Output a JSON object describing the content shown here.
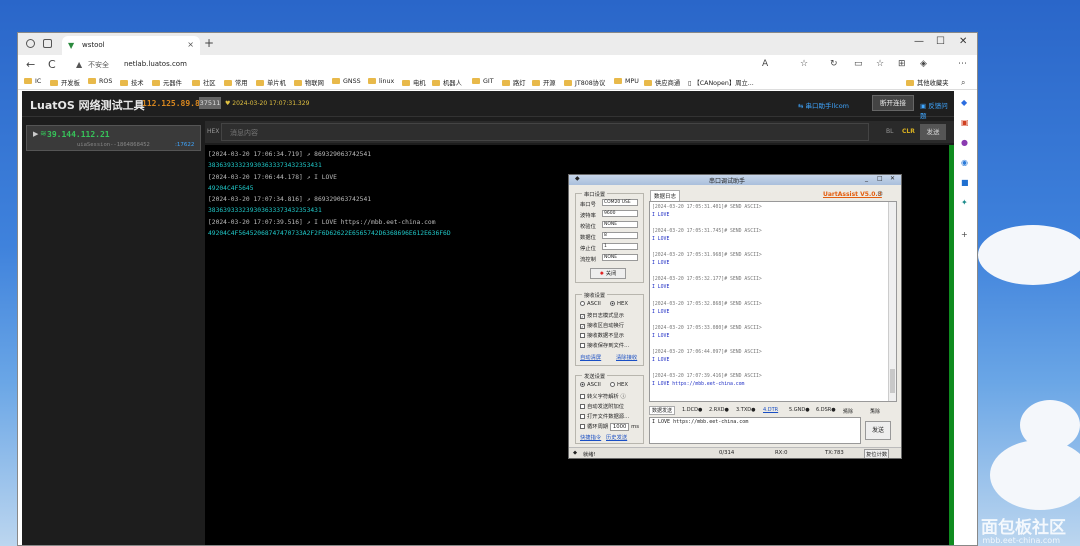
{
  "browser": {
    "tab_title": "wstool",
    "tab_close": "×",
    "new_tab": "+",
    "win_min": "—",
    "win_max": "☐",
    "win_close": "✕",
    "insecure_label": "不安全",
    "url": "netlab.luatos.com",
    "nav_back": "←",
    "nav_refresh": "C",
    "bookmarks": [
      "IC",
      "开发板",
      "ROS",
      "技术",
      "元器件",
      "社区",
      "常用",
      "单片机",
      "物联网",
      "GNSS",
      "linux",
      "电机",
      "机器人",
      "GIT",
      "路灯",
      "开源",
      "JT808协议",
      "MPU",
      "供应商通",
      "【CANopen】周立..."
    ],
    "other_bookmarks": "其他收藏夹"
  },
  "app": {
    "logo": "LuatOS 网络测试工具",
    "server_ip": "112.125.89.8:",
    "server_port": "37511",
    "connected_time": "2024-03-20 17:07:31.329",
    "assist_link": "串口助手llcom",
    "disconnect_label": "断开连接",
    "feedback_link": "反馈问题",
    "client": {
      "ip": "39.144.112.21",
      "session": "uiaSession--1864868452",
      "port_count": ":17622"
    },
    "sendbar": {
      "hex_label": "HEX",
      "placeholder": "消息内容",
      "bl_label": "BL",
      "clr_label": "CLR",
      "send_label": "发送"
    },
    "log": [
      {
        "ts": "[2024-03-20 17:06:34.719]",
        "msg": "869329063742541",
        "data": "383639333239303633373432353431"
      },
      {
        "ts": "[2024-03-20 17:06:44.178]",
        "msg": "I LOVE",
        "data": "49204C4F5645"
      },
      {
        "ts": "[2024-03-20 17:07:34.816]",
        "msg": "869329063742541",
        "data": "383639333239303633373432353431"
      },
      {
        "ts": "[2024-03-20 17:07:39.516]",
        "msg": "I LOVE https://mbb.eet-china.com",
        "data": "49204C4F56452068747470733A2F2F6D62622E6565742D6368696E612E636F6D"
      }
    ]
  },
  "serial": {
    "title": "串口调试助手",
    "port_group": "串口设置",
    "fields": [
      {
        "label": "串口号",
        "value": "COM20 USE"
      },
      {
        "label": "波特率",
        "value": "9600"
      },
      {
        "label": "校验位",
        "value": "NONE"
      },
      {
        "label": "数据位",
        "value": "8"
      },
      {
        "label": "停止位",
        "value": "1"
      },
      {
        "label": "流控制",
        "value": "NONE"
      }
    ],
    "close_label": "关闭",
    "recv_group": "接收设置",
    "recv_ascii": "ASCII",
    "recv_hex": "HEX",
    "recv_options": [
      "按日志模式显示",
      "接收区自动换行",
      "接收数据不显示",
      "接收保存到文件..."
    ],
    "recv_links": [
      "自动清屏",
      "清除接收"
    ],
    "send_group": "发送设置",
    "send_ascii": "ASCII",
    "send_hex": "HEX",
    "send_options": [
      "转义字符解析",
      "自动发送附加位",
      "打开文件数据源...",
      "循环周期"
    ],
    "cycle_value": "1000",
    "cycle_unit": "ms",
    "send_links": [
      "快捷指令",
      "历史发送"
    ],
    "log_tab": "数据日志",
    "brand": "UartAssist V5.0.3",
    "recv_log": [
      {
        "ts": "[2024-03-20 17:05:31.401]# SEND ASCII>",
        "msg": "I LOVE"
      },
      {
        "ts": "[2024-03-20 17:05:31.745]# SEND ASCII>",
        "msg": "I LOVE"
      },
      {
        "ts": "[2024-03-20 17:05:31.968]# SEND ASCII>",
        "msg": "I LOVE"
      },
      {
        "ts": "[2024-03-20 17:05:32.177]# SEND ASCII>",
        "msg": "I LOVE"
      },
      {
        "ts": "[2024-03-20 17:05:32.868]# SEND ASCII>",
        "msg": "I LOVE"
      },
      {
        "ts": "[2024-03-20 17:05:33.080]# SEND ASCII>",
        "msg": "I LOVE"
      },
      {
        "ts": "[2024-03-20 17:06:44.097]# SEND ASCII>",
        "msg": "I LOVE"
      },
      {
        "ts": "[2024-03-20 17:07:39.416]# SEND ASCII>",
        "msg": "I LOVE https://mbb.eet-china.com"
      }
    ],
    "send_tabs": [
      "数据发送",
      "1.DCD●",
      "2.RXD●",
      "3.TXD●",
      "4.DTR",
      "5.GND●",
      "6.DSR●",
      "清除",
      "清除"
    ],
    "send_text": "I LOVE https://mbb.eet-china.com",
    "send_button": "发送",
    "status_ready": "就绪!",
    "status_count": "0/314",
    "status_rx": "RX:0",
    "status_tx": "TX:783",
    "reset_count": "复位计数"
  },
  "watermark": {
    "title": "面包板社区",
    "url": "mbb.eet-china.com"
  },
  "colors": {
    "accent_green": "#37c45a",
    "accent_cyan": "#20c8c8",
    "server_orange": "#d8871f",
    "brand_orange": "#e35d0f"
  }
}
